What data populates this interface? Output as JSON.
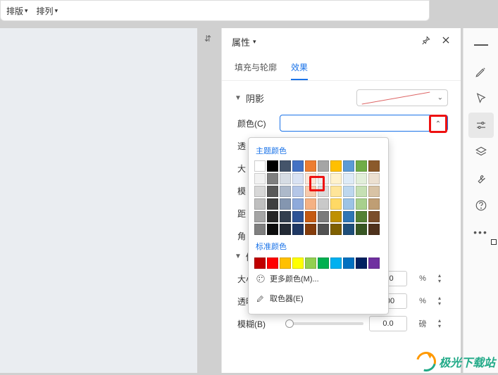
{
  "top_menu": {
    "layout": "排版",
    "arrange": "排列"
  },
  "panel": {
    "title": "属性",
    "tabs": {
      "fill_outline": "填充与轮廓",
      "effects": "效果"
    },
    "shadow_section": "阴影",
    "rows": {
      "color": "颜色(C)",
      "tr1": "透",
      "tr2": "大",
      "tr3": "模",
      "tr4": "距",
      "tr5": "角",
      "bevel": "倒"
    },
    "sliders": {
      "size": {
        "label": "大小(S)",
        "value": "0.0",
        "unit": "%"
      },
      "opacity": {
        "label": "透明度(T)",
        "value": "100",
        "unit": "%"
      },
      "blur": {
        "label": "模糊(B)",
        "value": "0.0",
        "unit": "磅"
      }
    }
  },
  "picker": {
    "theme_title": "主题颜色",
    "standard_title": "标准颜色",
    "more_colors": "更多颜色(M)...",
    "eyedropper": "取色器(E)",
    "theme_rows": [
      [
        "#ffffff",
        "#000000",
        "#44546a",
        "#4472c4",
        "#ed7d31",
        "#a5a5a5",
        "#ffc000",
        "#5b9bd5",
        "#70ad47",
        "#8b5a2b"
      ],
      [
        "#f2f2f2",
        "#7f7f7f",
        "#d6dce4",
        "#d9e2f3",
        "#fbe5d6",
        "#ededed",
        "#fff2cc",
        "#deebf7",
        "#e2efda",
        "#ece0d1"
      ],
      [
        "#d8d8d8",
        "#595959",
        "#adb9ca",
        "#b4c6e7",
        "#f7caac",
        "#dbdbdb",
        "#ffe599",
        "#bdd7ee",
        "#c5e0b3",
        "#d8c3a5"
      ],
      [
        "#bfbfbf",
        "#3f3f3f",
        "#8496b0",
        "#8eaadb",
        "#f4b183",
        "#c9c9c9",
        "#ffd965",
        "#9cc3e5",
        "#a8d08d",
        "#bf9e74"
      ],
      [
        "#a5a5a5",
        "#262626",
        "#323f4f",
        "#2f5496",
        "#c55a11",
        "#7b7b7b",
        "#bf9000",
        "#2e75b5",
        "#538135",
        "#7a4e2b"
      ],
      [
        "#7f7f7f",
        "#0c0c0c",
        "#222a35",
        "#1f3864",
        "#843c0b",
        "#525252",
        "#7f6000",
        "#1e4e79",
        "#375623",
        "#4f321c"
      ]
    ],
    "standard_row": [
      "#c00000",
      "#ff0000",
      "#ffc000",
      "#ffff00",
      "#92d050",
      "#00b050",
      "#00b0f0",
      "#0070c0",
      "#002060",
      "#7030a0"
    ]
  },
  "watermark": "极光下载站"
}
